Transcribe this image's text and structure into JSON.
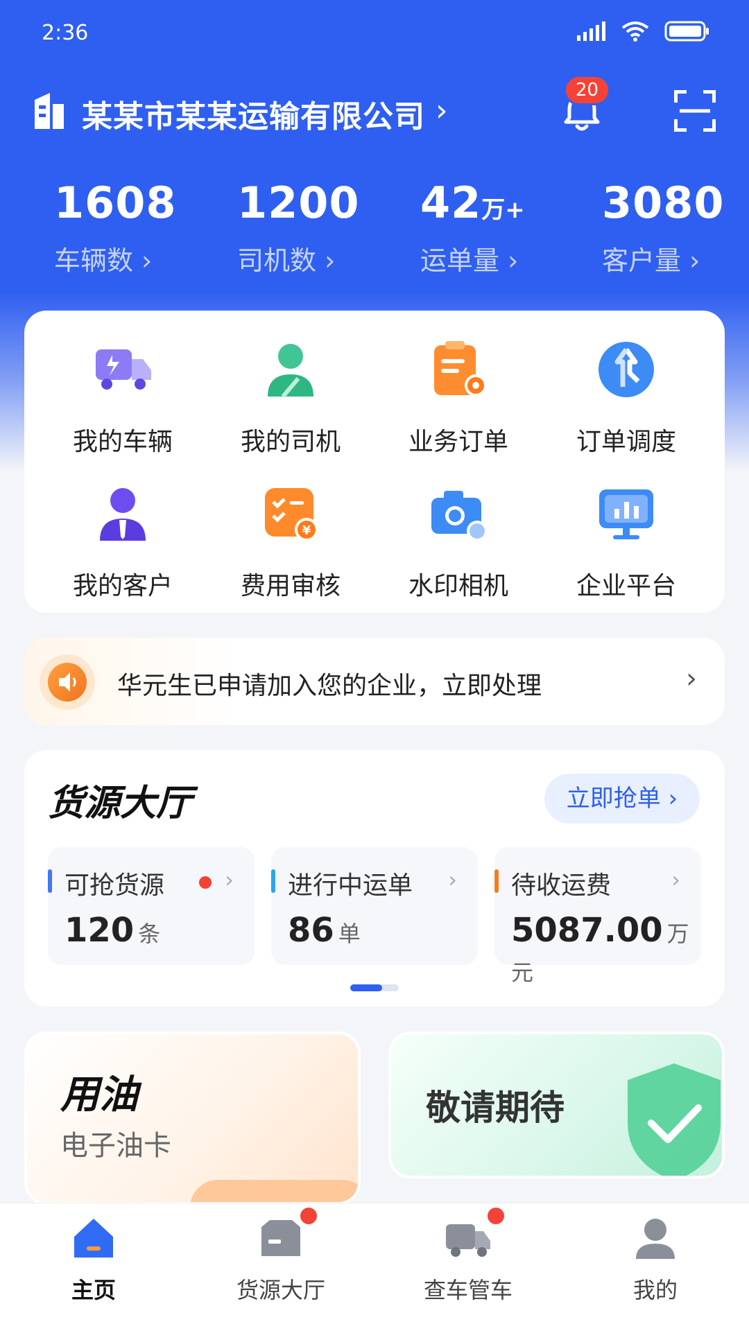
{
  "status_bar": {
    "time": "2:36"
  },
  "header": {
    "company_name": "某某市某某运输有限公司",
    "notification_count": "20"
  },
  "stats": [
    {
      "value": "1608",
      "unit": "",
      "label": "车辆数 ›"
    },
    {
      "value": "1200",
      "unit": "",
      "label": "司机数 ›"
    },
    {
      "value": "42",
      "unit": "万+",
      "label": "运单量 ›"
    },
    {
      "value": "3080",
      "unit": "",
      "label": "客户量 ›"
    }
  ],
  "grid": [
    {
      "label": "我的车辆",
      "icon": "truck-icon"
    },
    {
      "label": "我的司机",
      "icon": "driver-icon"
    },
    {
      "label": "业务订单",
      "icon": "order-icon"
    },
    {
      "label": "订单调度",
      "icon": "dispatch-icon"
    },
    {
      "label": "我的客户",
      "icon": "customer-icon"
    },
    {
      "label": "费用审核",
      "icon": "fee-review-icon"
    },
    {
      "label": "水印相机",
      "icon": "camera-icon"
    },
    {
      "label": "企业平台",
      "icon": "platform-icon"
    }
  ],
  "notice": {
    "text": "华元生已申请加入您的企业，立即处理"
  },
  "hall": {
    "title": "货源大厅",
    "button": "立即抢单 ›",
    "boxes": [
      {
        "label": "可抢货源",
        "value": "120",
        "unit": "条",
        "color": "#3f78f5"
      },
      {
        "label": "进行中运单",
        "value": "86",
        "unit": "单",
        "color": "#2aa7f0"
      },
      {
        "label": "待收运费",
        "value": "5087.00",
        "unit": "万元",
        "color": "#f57c1f"
      }
    ]
  },
  "oil": {
    "title": "用油",
    "subtitle": "电子油卡"
  },
  "soon": {
    "text": "敬请期待"
  },
  "tabs": [
    {
      "label": "主页",
      "icon": "home-icon"
    },
    {
      "label": "货源大厅",
      "icon": "cargo-hall-icon"
    },
    {
      "label": "查车管车",
      "icon": "vehicle-manage-icon"
    },
    {
      "label": "我的",
      "icon": "profile-icon"
    }
  ],
  "colors": {
    "primary": "#2f5ff0",
    "badge": "#f44336"
  }
}
